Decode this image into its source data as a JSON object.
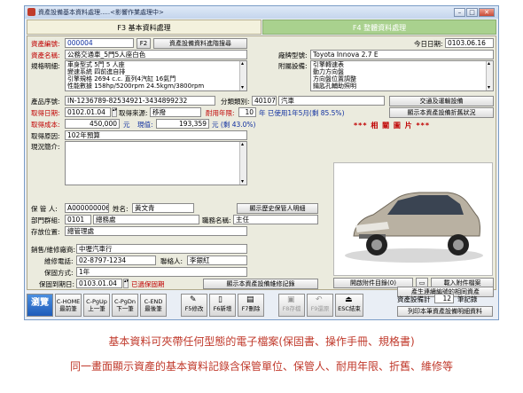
{
  "window": {
    "title": "資產設備基本資料處理.....<影響作業處理中>",
    "btn_min": "–",
    "btn_max": "□",
    "btn_close": "✕"
  },
  "tabs": [
    "F3 基本資料處理",
    "F4 整體資料處理"
  ],
  "form": {
    "asset_no_label": "資產編號:",
    "asset_no": "000004",
    "f2_btn": "F2",
    "search_btn": "資產設備資料進階搜尋",
    "today_label": "今日日期:",
    "today": "0103.06.16",
    "name_label": "資產名稱:",
    "name": "公務交通車_5門5人座白色",
    "model_label": "廠牌型號:",
    "model": "Toyota Innova 2.7 E",
    "spec_label": "規格明細:",
    "spec_lines": [
      "車身型式 5門 5 人座",
      "變速系統 四前進自排",
      "引擎規格 2694 c.c. 直列4汽缸 16氣門",
      "性能數據 158hp/5200rpm 24.5kgm/3800rpm"
    ],
    "accessory_label": "附屬設備:",
    "accessory_lines": [
      "引擎轉速表",
      "動力方向盤",
      "方向盤位置調整",
      "鑰匙孔輔助照明"
    ],
    "serial_label": "產品序號:",
    "serial": "IN-1236789-82534921-3434899232",
    "category_label": "分類類別:",
    "category_code": "40107",
    "category_name": "汽車",
    "category_btn": "交通及運輸設備",
    "acq_date_label": "取得日期:",
    "acq_date": "0102.01.04",
    "source_label": "取得來源:",
    "source": "移撥",
    "life_label": "耐用年限:",
    "life": "10",
    "life_used": "年 已使用1年5月(剩 85.5%)",
    "depr_btn": "顯示本資產設備折舊狀況",
    "cost_label": "取得成本:",
    "cost": "450,000",
    "cost_unit": "元",
    "current_label": "現值:",
    "current": "193,359",
    "current_note": "元 (剩 43.0%)",
    "reason_label": "取得原因:",
    "reason": "102年預算",
    "status_label": "現況簡介:",
    "photo_title": "*** 相 關 圖 片 ***",
    "keeper_label": "保 管 人:",
    "keeper_id": "A000000006",
    "keeper_name_label": "姓名:",
    "keeper_name": "黃文青",
    "keeper_btn": "顯示歷史保管人明細",
    "dept_label": "部門群組:",
    "dept_code": "0101",
    "dept_name": "總務處",
    "title_label": "職務名稱:",
    "job_title": "主任",
    "location_label": "存放位置:",
    "location": "總管理處",
    "vendor_label": "銷售/維修廠商:",
    "vendor": "中壢汽車行",
    "phone_label": "維修電話:",
    "phone": "02-8797-1234",
    "contact_label": "聯絡人:",
    "contact": "李銀紅",
    "warranty_label": "保固方式:",
    "warranty": "1年",
    "warranty_date_label": "保固到期日:",
    "warranty_date": "0103.01.04",
    "expired": "已過保固期",
    "repair_btn": "顯示本資產設備維修記錄",
    "attach_btn": "開啟附件目錄(0)",
    "attach_icon_btn": "▭",
    "download_btn": "載入附件檔案",
    "related_btn": "產生連續編號的相同資產"
  },
  "toolbar": {
    "browse": "瀏覽",
    "home": "C-HOME\n最前筆",
    "pgup": "C-PgUp\n上一筆",
    "pgdn": "C-PgDn\n下一筆",
    "end": "C-END\n最後筆",
    "f5": "F5修改",
    "f6": "F6新增",
    "f7": "F7刪除",
    "f8": "F8存檔",
    "f9": "F9還原",
    "esc": "ESC結束",
    "total_label": "資產設備計",
    "total": "12",
    "total_unit": "筆記錄",
    "print_btn": "列印本筆資產設備明細資料"
  },
  "captions": [
    "基本資料可夾帶任何型態的電子檔案(保固書、操作手冊、規格書)",
    "同一畫面顯示資產的基本資料記錄含保管單位、保管人、耐用年限、折舊、維修等"
  ]
}
